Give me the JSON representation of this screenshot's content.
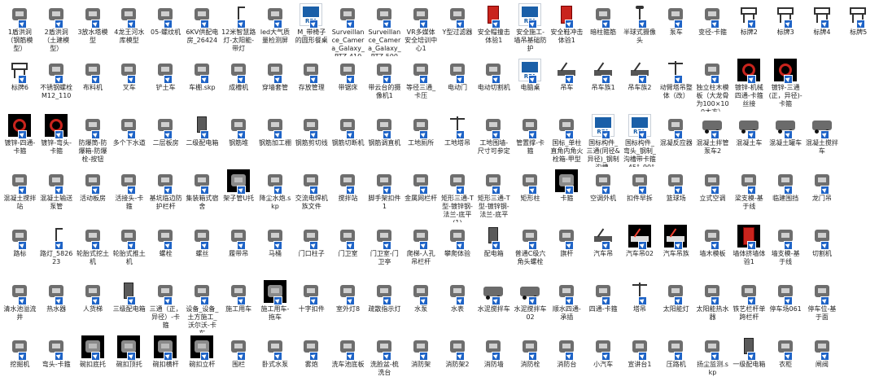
{
  "window": {
    "title": ""
  },
  "accent_color": "#1e63c6",
  "files": [
    {
      "label": "1盾洪洞（钢筋模型）",
      "icon": "sketch-icon",
      "style": "mid"
    },
    {
      "label": "2盾洪洞（土建模型）",
      "icon": "sketch-icon",
      "style": "mid"
    },
    {
      "label": "3放水塔模型",
      "icon": "tower-model-icon",
      "style": "mid"
    },
    {
      "label": "4龙王河水库模型",
      "icon": "dam-model-icon",
      "style": "mid"
    },
    {
      "label": "05-螺纹机",
      "icon": "machine-icon",
      "style": "mid"
    },
    {
      "label": "6KV供配电房_26424",
      "icon": "electric-room-icon",
      "style": "mid"
    },
    {
      "label": "12米智慧路灯-太阳能-带灯",
      "icon": "street-light-icon",
      "style": "mid"
    },
    {
      "label": "led大气质量检测屏",
      "icon": "led-sign-icon",
      "style": "mid"
    },
    {
      "label": "M_带椅子的圆形餐桌",
      "icon": "revit-family-icon",
      "style": "rfa"
    },
    {
      "label": "Surveillance_Camera_Galaxy_PTZ-410S...",
      "icon": "dome-camera-icon",
      "style": "mid"
    },
    {
      "label": "Surveillance_Camera_Galaxy_PTZ-500S...",
      "icon": "camera-icon",
      "style": "mid"
    },
    {
      "label": "VR多媒体安全培训中心1",
      "icon": "building-icon",
      "style": "mid"
    },
    {
      "label": "Y型过滤器",
      "icon": "filter-icon",
      "style": "mid"
    },
    {
      "label": "安全帽撞击体验1",
      "icon": "red-cabinet-icon",
      "style": "mid"
    },
    {
      "label": "安全施工-墙吊基础防护",
      "icon": "revit-family-icon",
      "style": "rfa"
    },
    {
      "label": "安全鞋冲击体验1",
      "icon": "red-cabinet-icon",
      "style": "mid"
    },
    {
      "label": "暗柱箍筋",
      "icon": "rebar-icon",
      "style": "mid"
    },
    {
      "label": "半球式摄像头",
      "icon": "pole-icon",
      "style": "mid"
    },
    {
      "label": "泵车",
      "icon": "pump-truck-icon",
      "style": "mid"
    },
    {
      "label": "变径-卡箍",
      "icon": "pipe-fitting-icon",
      "style": "mid"
    },
    {
      "label": "标牌2",
      "icon": "signboard-icon",
      "style": "mid"
    },
    {
      "label": "标牌3",
      "icon": "signboard-icon",
      "style": "mid"
    },
    {
      "label": "标牌4",
      "icon": "signboard-icon",
      "style": "mid"
    },
    {
      "label": "标牌5",
      "icon": "signboard-icon",
      "style": "mid"
    },
    {
      "label": "标牌6",
      "icon": "signboard-icon",
      "style": "mid"
    },
    {
      "label": "不锈钢螺栓M12_110",
      "icon": "bolt-plate-icon",
      "style": "mid"
    },
    {
      "label": "布料机",
      "icon": "spreader-icon",
      "style": "mid"
    },
    {
      "label": "叉车",
      "icon": "forklift-icon",
      "style": "mid"
    },
    {
      "label": "铲土车",
      "icon": "loader-icon",
      "style": "mid"
    },
    {
      "label": "车棚.skp",
      "icon": "sketch-icon",
      "style": "mid"
    },
    {
      "label": "成槽机",
      "icon": "trench-machine-icon",
      "style": "mid"
    },
    {
      "label": "穿墙套管",
      "icon": "sleeve-icon",
      "style": "mid"
    },
    {
      "label": "存放管理",
      "icon": "rack-icon",
      "style": "mid"
    },
    {
      "label": "带锯床",
      "icon": "saw-icon",
      "style": "mid"
    },
    {
      "label": "带云台的摄像机1",
      "icon": "camera-icon",
      "style": "mid"
    },
    {
      "label": "等径三通_卡压",
      "icon": "tee-icon",
      "style": "mid"
    },
    {
      "label": "电动门",
      "icon": "gate-icon",
      "style": "mid"
    },
    {
      "label": "电动切割机",
      "icon": "cutter-icon",
      "style": "mid"
    },
    {
      "label": "电脑桌",
      "icon": "revit-family-icon",
      "style": "rfa"
    },
    {
      "label": "吊车",
      "icon": "crane-truck-icon",
      "style": "mid"
    },
    {
      "label": "吊车族1",
      "icon": "crane-truck-icon",
      "style": "mid"
    },
    {
      "label": "吊车族2",
      "icon": "crane-truck-icon",
      "style": "mid"
    },
    {
      "label": "动臂塔吊整体（改）",
      "icon": "tower-crane-icon",
      "style": "mid"
    },
    {
      "label": "独立柱木模板（大龙骨为100×100木方）",
      "icon": "formwork-icon",
      "style": "mid"
    },
    {
      "label": "镀锌-机械四通-卡箍丝接",
      "icon": "valve-red-icon",
      "style": "dark"
    },
    {
      "label": "镀锌-三通(正，异径)-卡箍",
      "icon": "valve-red-icon",
      "style": "dark"
    },
    {
      "label": "",
      "icon": "blank",
      "style": "mid"
    },
    {
      "label": "",
      "icon": "blank",
      "style": "mid"
    },
    {
      "label": "镀锌-四通-卡箍",
      "icon": "valve-red-icon",
      "style": "dark"
    },
    {
      "label": "镀锌-弯头-卡箍",
      "icon": "valve-red-icon",
      "style": "dark"
    },
    {
      "label": "防爆筒-防爆箱-防爆栓-按钮",
      "icon": "panel-icon",
      "style": "mid"
    },
    {
      "label": "多个下水道",
      "icon": "drain-icon",
      "style": "mid"
    },
    {
      "label": "二层板房",
      "icon": "house-icon",
      "style": "mid"
    },
    {
      "label": "二级配电箱",
      "icon": "switchbox-icon",
      "style": "mid"
    },
    {
      "label": "钢筋堆",
      "icon": "rebar-stack-icon",
      "style": "mid"
    },
    {
      "label": "钢筋加工棚",
      "icon": "shed-icon",
      "style": "mid"
    },
    {
      "label": "钢筋剪切线",
      "icon": "line-icon",
      "style": "mid"
    },
    {
      "label": "钢筋切断机",
      "icon": "cutter-green-icon",
      "style": "mid"
    },
    {
      "label": "钢筋调直机",
      "icon": "machine-icon",
      "style": "mid"
    },
    {
      "label": "工地厕所",
      "icon": "toilet-icon",
      "style": "mid"
    },
    {
      "label": "工地塔吊",
      "icon": "tower-crane-icon",
      "style": "mid"
    },
    {
      "label": "工地围墙-尺寸可参定",
      "icon": "fence-icon",
      "style": "mid"
    },
    {
      "label": "管置撑-卡箍",
      "icon": "pipe-fitting-icon",
      "style": "mid"
    },
    {
      "label": "国标_单柱直角内角火栓箱-甲型",
      "icon": "hydrant-box-icon",
      "style": "mid"
    },
    {
      "label": "国标构件_三通(同径&异径)_钢制_沟槽...",
      "icon": "revit-family-icon",
      "style": "rfa"
    },
    {
      "label": "国标构件_弯头_钢制_沟槽带卡箍_45°_90°",
      "icon": "revit-family-icon",
      "style": "rfa"
    },
    {
      "label": "混凝反应器",
      "icon": "reactor-icon",
      "style": "mid"
    },
    {
      "label": "混凝土拌管泵车2",
      "icon": "mixer-truck-icon",
      "style": "mid"
    },
    {
      "label": "混凝土车",
      "icon": "mixer-truck-icon",
      "style": "mid"
    },
    {
      "label": "混凝土罐车",
      "icon": "mixer-truck-icon",
      "style": "mid"
    },
    {
      "label": "混凝土搅拌车",
      "icon": "mixer-truck-icon",
      "style": "mid"
    },
    {
      "label": "",
      "icon": "blank",
      "style": "mid"
    },
    {
      "label": "混凝土搅拌站",
      "icon": "plant-icon",
      "style": "mid"
    },
    {
      "label": "混凝土输送泵管",
      "icon": "pump-pipe-icon",
      "style": "mid"
    },
    {
      "label": "活动板房",
      "icon": "house-icon",
      "style": "mid"
    },
    {
      "label": "活接头-卡箍",
      "icon": "union-icon",
      "style": "mid"
    },
    {
      "label": "基坑临边防护栏杆",
      "icon": "railing-icon",
      "style": "mid"
    },
    {
      "label": "集装箱式宿舍",
      "icon": "container-icon",
      "style": "mid"
    },
    {
      "label": "架子管U托",
      "icon": "scaffold-icon",
      "style": "dark"
    },
    {
      "label": "降尘水炮.skp",
      "icon": "sketch-icon",
      "style": "mid"
    },
    {
      "label": "交流电焊机族文件",
      "icon": "welder-icon",
      "style": "mid"
    },
    {
      "label": "搅拌站",
      "icon": "plant-icon",
      "style": "mid"
    },
    {
      "label": "脚手架扣件1",
      "icon": "clamp-icon",
      "style": "mid"
    },
    {
      "label": "金属网栏杆",
      "icon": "mesh-fence-icon",
      "style": "mid"
    },
    {
      "label": "矩形三通-T型-镀锌钢-法兰-底平(1)",
      "icon": "duct-icon",
      "style": "mid"
    },
    {
      "label": "矩形三通-T型-镀锌钢-法兰-底平",
      "icon": "duct-icon",
      "style": "mid"
    },
    {
      "label": "矩形柱",
      "icon": "column-icon",
      "style": "mid"
    },
    {
      "label": "卡箍",
      "icon": "clamp-icon",
      "style": "dark"
    },
    {
      "label": "空调外机",
      "icon": "ac-unit-icon",
      "style": "mid"
    },
    {
      "label": "扣件早拆",
      "icon": "clamp-icon",
      "style": "mid"
    },
    {
      "label": "篮球场",
      "icon": "court-icon",
      "style": "mid"
    },
    {
      "label": "立式空调",
      "icon": "ac-stand-icon",
      "style": "mid"
    },
    {
      "label": "梁支模-基于线",
      "icon": "beam-form-icon",
      "style": "mid"
    },
    {
      "label": "临建围挡",
      "icon": "fence-icon",
      "style": "mid"
    },
    {
      "label": "龙门吊",
      "icon": "gantry-icon",
      "style": "mid"
    },
    {
      "label": "",
      "icon": "blank",
      "style": "mid"
    },
    {
      "label": "路标",
      "icon": "road-sign-icon",
      "style": "mid"
    },
    {
      "label": "路灯_582623",
      "icon": "street-light-icon",
      "style": "mid"
    },
    {
      "label": "轮胎式挖土机",
      "icon": "excavator-icon",
      "style": "mid"
    },
    {
      "label": "轮胎式推土机",
      "icon": "bulldozer-icon",
      "style": "mid"
    },
    {
      "label": "螺栓",
      "icon": "bolt-icon",
      "style": "mid"
    },
    {
      "label": "螺丝",
      "icon": "screw-icon",
      "style": "mid"
    },
    {
      "label": "履带吊",
      "icon": "crawler-crane-icon",
      "style": "mid"
    },
    {
      "label": "马桶",
      "icon": "toilet-icon",
      "style": "mid"
    },
    {
      "label": "门口柱子",
      "icon": "pillar-icon",
      "style": "mid"
    },
    {
      "label": "门卫室",
      "icon": "guard-house-icon",
      "style": "mid"
    },
    {
      "label": "门卫室-门卫亭",
      "icon": "guard-house-icon",
      "style": "mid"
    },
    {
      "label": "爬梯-人孔吊栏杆",
      "icon": "ladder-icon",
      "style": "mid"
    },
    {
      "label": "攀爬体验",
      "icon": "climb-frame-icon",
      "style": "mid"
    },
    {
      "label": "配电箱",
      "icon": "switchbox-icon",
      "style": "mid"
    },
    {
      "label": "普通C级六角头螺栓",
      "icon": "bolt-icon",
      "style": "mid"
    },
    {
      "label": "旗杆",
      "icon": "flagpole-icon",
      "style": "mid"
    },
    {
      "label": "汽车吊",
      "icon": "crane-truck-icon",
      "style": "mid"
    },
    {
      "label": "汽车吊02",
      "icon": "crane-truck-icon",
      "style": "dark"
    },
    {
      "label": "汽车吊族",
      "icon": "crane-truck-icon",
      "style": "dark"
    },
    {
      "label": "墙木模板",
      "icon": "wall-form-icon",
      "style": "mid"
    },
    {
      "label": "墙体挤墙体验1",
      "icon": "red-cabinet-icon",
      "style": "dark"
    },
    {
      "label": "墙支模-基于线",
      "icon": "beam-form-icon",
      "style": "mid"
    },
    {
      "label": "切割机",
      "icon": "cutter-icon",
      "style": "mid"
    },
    {
      "label": "",
      "icon": "blank",
      "style": "mid"
    },
    {
      "label": "清水池溢流井",
      "icon": "tank-icon",
      "style": "mid"
    },
    {
      "label": "热水器",
      "icon": "water-heater-icon",
      "style": "mid"
    },
    {
      "label": "人货梯",
      "icon": "hoist-icon",
      "style": "mid"
    },
    {
      "label": "三级配电箱",
      "icon": "switchbox-icon",
      "style": "mid"
    },
    {
      "label": "三通（正，异径）-卡箍",
      "icon": "tee-icon",
      "style": "mid"
    },
    {
      "label": "设备_设备_土方施工_沃尔沃-卡车",
      "icon": "dump-truck-icon",
      "style": "mid"
    },
    {
      "label": "施工用车",
      "icon": "truck-icon",
      "style": "mid"
    },
    {
      "label": "施工用车-拖车",
      "icon": "truck-icon",
      "style": "dark"
    },
    {
      "label": "十字扣件",
      "icon": "clamp-icon",
      "style": "mid"
    },
    {
      "label": "室外灯8",
      "icon": "lamp-icon",
      "style": "mid"
    },
    {
      "label": "疏散指示灯",
      "icon": "exit-sign-icon",
      "style": "mid"
    },
    {
      "label": "水泵",
      "icon": "pump-icon",
      "style": "mid"
    },
    {
      "label": "水表",
      "icon": "meter-icon",
      "style": "mid"
    },
    {
      "label": "水泥搅拌车",
      "icon": "mixer-truck-icon",
      "style": "mid"
    },
    {
      "label": "水泥搅拌车02",
      "icon": "mixer-truck-icon",
      "style": "mid"
    },
    {
      "label": "顺水四通-承插",
      "icon": "cross-fitting-icon",
      "style": "mid"
    },
    {
      "label": "四通-卡箍",
      "icon": "cross-fitting-icon",
      "style": "mid"
    },
    {
      "label": "塔吊",
      "icon": "tower-crane-icon",
      "style": "mid"
    },
    {
      "label": "太阳能灯",
      "icon": "solar-lamp-icon",
      "style": "mid"
    },
    {
      "label": "太阳能热水器",
      "icon": "solar-panel-icon",
      "style": "mid"
    },
    {
      "label": "铁艺栏杆单跨栏杆",
      "icon": "railing-icon",
      "style": "mid"
    },
    {
      "label": "停车场061",
      "icon": "parking-icon",
      "style": "mid"
    },
    {
      "label": "停车位-基于面",
      "icon": "parking-icon",
      "style": "mid"
    },
    {
      "label": "",
      "icon": "blank",
      "style": "mid"
    },
    {
      "label": "挖掘机",
      "icon": "excavator-icon",
      "style": "mid"
    },
    {
      "label": "弯头-卡箍",
      "icon": "elbow-icon",
      "style": "mid"
    },
    {
      "label": "碗扣底托",
      "icon": "base-plate-icon",
      "style": "dark"
    },
    {
      "label": "碗扣顶托",
      "icon": "base-plate-icon",
      "style": "dark"
    },
    {
      "label": "碗扣横杆",
      "icon": "bar-icon",
      "style": "dark"
    },
    {
      "label": "碗扣立杆",
      "icon": "bar-icon",
      "style": "dark"
    },
    {
      "label": "围栏",
      "icon": "fence-icon",
      "style": "mid"
    },
    {
      "label": "卧式水泵",
      "icon": "pump-icon",
      "style": "mid"
    },
    {
      "label": "雾炮",
      "icon": "fog-cannon-icon",
      "style": "mid"
    },
    {
      "label": "洗车池底板",
      "icon": "slab-icon",
      "style": "mid"
    },
    {
      "label": "洗脸盆-梳洗台",
      "icon": "basin-icon",
      "style": "mid"
    },
    {
      "label": "消防架",
      "icon": "fire-rack-icon",
      "style": "mid"
    },
    {
      "label": "消防架2",
      "icon": "fire-rack-icon",
      "style": "mid"
    },
    {
      "label": "消防墙",
      "icon": "fire-wall-icon",
      "style": "mid"
    },
    {
      "label": "消防栓",
      "icon": "hydrant-icon",
      "style": "mid"
    },
    {
      "label": "消防台",
      "icon": "fire-rack-icon",
      "style": "mid"
    },
    {
      "label": "小汽车",
      "icon": "car-icon",
      "style": "mid"
    },
    {
      "label": "宣讲台1",
      "icon": "stage-icon",
      "style": "mid"
    },
    {
      "label": "压路机",
      "icon": "roller-icon",
      "style": "mid"
    },
    {
      "label": "扬尘监测.skp",
      "icon": "sketch-icon",
      "style": "mid"
    },
    {
      "label": "一级配电箱",
      "icon": "switchbox-icon",
      "style": "mid"
    },
    {
      "label": "衣柜",
      "icon": "wardrobe-icon",
      "style": "mid"
    },
    {
      "label": "闸阀",
      "icon": "gate-valve-icon",
      "style": "mid"
    },
    {
      "label": "",
      "icon": "blank",
      "style": "mid"
    }
  ]
}
